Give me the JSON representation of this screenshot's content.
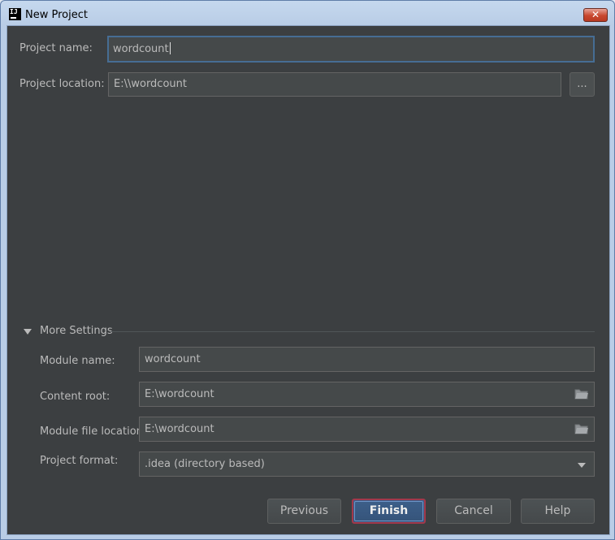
{
  "window": {
    "title": "New Project",
    "app_icon_text": "IJ",
    "close_glyph": "✕"
  },
  "project": {
    "name_label": "Project name:",
    "name_value": "wordcount",
    "location_label": "Project location:",
    "location_value": "E:\\\\wordcount",
    "browse_label": "..."
  },
  "more_settings": {
    "title": "More Settings",
    "module_name_label": "Module name:",
    "module_name_value": "wordcount",
    "content_root_label": "Content root:",
    "content_root_value": "E:\\wordcount",
    "module_file_label": "Module file location:",
    "module_file_value": "E:\\wordcount",
    "project_format_label": "Project format:",
    "project_format_value": ".idea (directory based)"
  },
  "buttons": {
    "previous": "Previous",
    "finish": "Finish",
    "cancel": "Cancel",
    "help": "Help"
  },
  "colors": {
    "panel_bg": "#3c3f41",
    "field_bg": "#45494a",
    "focus_border": "#466d94",
    "primary_button": "#365880"
  },
  "icons": [
    "app-icon",
    "close-icon",
    "expand-triangle-icon",
    "folder-icon",
    "dropdown-arrow-icon"
  ]
}
